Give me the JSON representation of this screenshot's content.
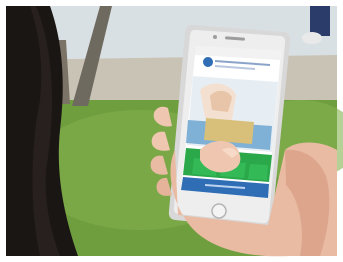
{
  "photo": {
    "subject": "hand-holding-smartphone",
    "colors": {
      "grass": "#6c9b3e",
      "sky": "#dfe6ea",
      "hair": "#1a1614",
      "skin": "#efc7b1",
      "phone_body": "#d9d9d9",
      "screen_green": "#2aa84a",
      "screen_blue": "#2f6db5"
    }
  }
}
